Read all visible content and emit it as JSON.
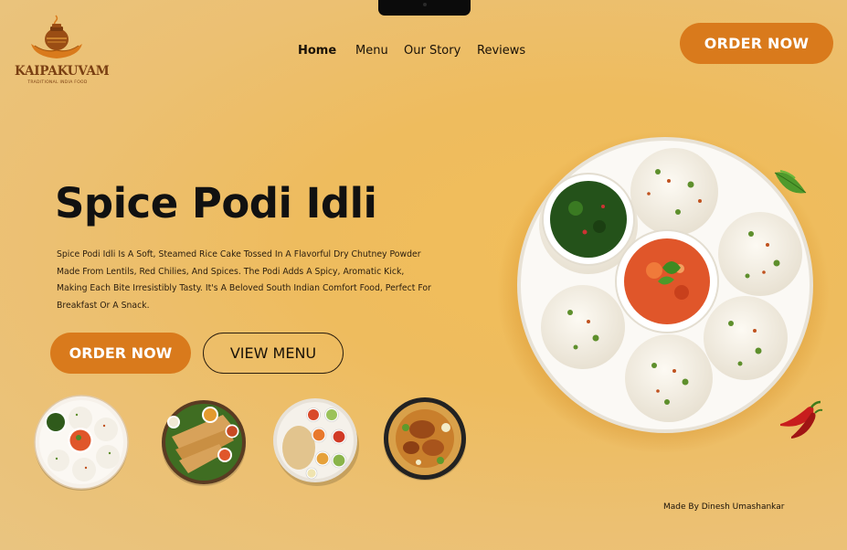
{
  "brand": {
    "name": "KAIPAKUVAM",
    "tagline": "TRADITIONAL INDIA FOOD"
  },
  "nav": {
    "items": [
      {
        "label": "Home",
        "active": true
      },
      {
        "label": "Menu",
        "active": false
      },
      {
        "label": "Our Story",
        "active": false
      },
      {
        "label": "Reviews",
        "active": false
      }
    ],
    "cta_label": "ORDER NOW"
  },
  "hero": {
    "title": "Spice Podi Idli",
    "description": "Spice Podi Idli Is A Soft, Steamed Rice Cake Tossed In A Flavorful Dry Chutney Powder Made From Lentils, Red Chilies, And Spices. The Podi Adds A Spicy, Aromatic Kick, Making Each Bite Irresistibly Tasty. It's A Beloved South Indian Comfort Food, Perfect For Breakfast Or A Snack.",
    "primary_button": "ORDER NOW",
    "secondary_button": "VIEW MENU"
  },
  "thumbnails": [
    {
      "icon": "idli-plate-thumb-icon"
    },
    {
      "icon": "dosa-plate-thumb-icon"
    },
    {
      "icon": "thali-plate-thumb-icon"
    },
    {
      "icon": "biryani-plate-thumb-icon"
    }
  ],
  "footer": {
    "credit": "Made By Dinesh Umashankar"
  },
  "colors": {
    "accent": "#d97a1c",
    "background": "#efbe60",
    "text": "#1a1208",
    "logo": "#7a3f12"
  }
}
